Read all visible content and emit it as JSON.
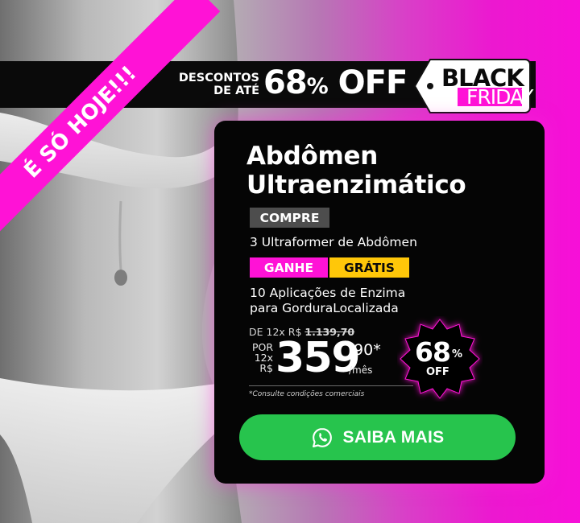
{
  "ribbon": {
    "text": "É SÓ HOJE!!!"
  },
  "top_bar": {
    "discount_prefix": "DESCONTOS",
    "discount_prefix_2": "DE ATÉ",
    "discount_value": "68",
    "discount_percent": "%",
    "discount_off": "OFF"
  },
  "black_friday": {
    "line1": "BLACK",
    "line2": "FRIDAY"
  },
  "offer": {
    "title_line1": "Abdômen",
    "title_line2": "Ultraenzimático",
    "buy_label": "COMPRE",
    "buy_item": "3 Ultraformer de Abdômen",
    "gain_label": "GANHE",
    "free_label": "GRÁTIS",
    "gain_item_line1": "10 Aplicações de Enzima",
    "gain_item_line2": "para GorduraLocalizada"
  },
  "price": {
    "from_label": "DE 12x R$",
    "old_price": "1.139,70",
    "por_label": "POR",
    "installments": "12x",
    "currency": "R$",
    "main": "359",
    "cents": ",90*",
    "per_month": "/mês",
    "disclaimer": "*Consulte condições comerciais"
  },
  "badge": {
    "value": "68",
    "percent": "%",
    "off": "OFF"
  },
  "cta": {
    "label": "SAIBA MAIS",
    "icon": "whatsapp-icon"
  },
  "colors": {
    "accent_pink": "#ff12d6",
    "gratis_yellow": "#ffc709",
    "cta_green": "#27c44d",
    "card_bg": "#050505"
  }
}
